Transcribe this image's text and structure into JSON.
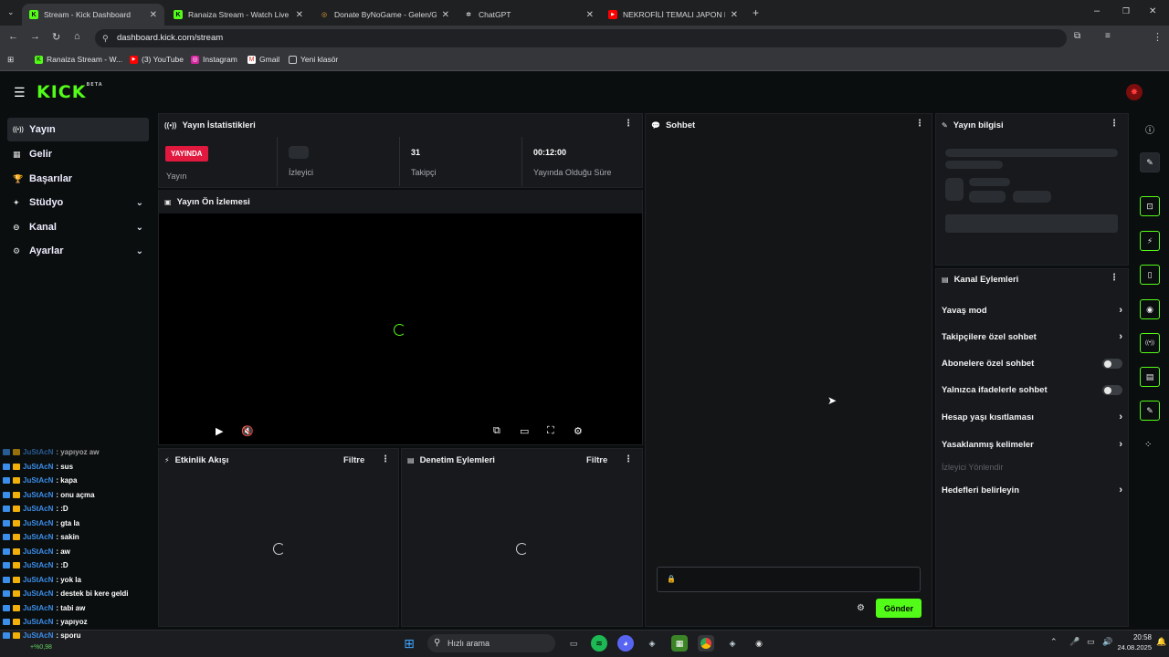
{
  "browser": {
    "tabs": [
      {
        "title": "Stream - Kick Dashboard",
        "fav": "K",
        "favcolor": "#53fc18"
      },
      {
        "title": "Ranaiza Stream - Watch Live on",
        "fav": "K",
        "favcolor": "#53fc18"
      },
      {
        "title": "Donate ByNoGame - Gelen/Gid",
        "fav": "◎",
        "favcolor": "#f2a43a"
      },
      {
        "title": "ChatGPT",
        "fav": "✲",
        "favcolor": "#ffffff"
      },
      {
        "title": "NEKROFİLİ TEMALI JAPON KOR",
        "fav": "▶",
        "favcolor": "#ff0000"
      }
    ],
    "url": "dashboard.kick.com/stream",
    "bookmarks": [
      "Ranaiza Stream - W...",
      "(3) YouTube",
      "Instagram",
      "Gmail",
      "Yeni klasör"
    ]
  },
  "kick": {
    "logo": "KICK",
    "logo_sup": "BETA"
  },
  "sidebar": {
    "items": [
      {
        "label": "Yayın",
        "icon": "((•))",
        "chev": ""
      },
      {
        "label": "Gelir",
        "icon": "▦",
        "chev": ""
      },
      {
        "label": "Başarılar",
        "icon": "🏆",
        "chev": ""
      },
      {
        "label": "Stüdyo",
        "icon": "✦",
        "chev": "⌄"
      },
      {
        "label": "Kanal",
        "icon": "⊖",
        "chev": "⌄"
      },
      {
        "label": "Ayarlar",
        "icon": "⚙",
        "chev": "⌄"
      }
    ]
  },
  "stats": {
    "title": "Yayın İstatistikleri",
    "live_badge": "YAYINDA",
    "live_label": "Yayın",
    "viewers_label": "İzleyici",
    "followers_value": "31",
    "followers_label": "Takipçi",
    "uptime_value": "00:12:00",
    "uptime_label": "Yayında Olduğu Süre"
  },
  "preview": {
    "title": "Yayın Ön İzlemesi"
  },
  "activity": {
    "title": "Etkinlik Akışı",
    "filter": "Filtre"
  },
  "moderation": {
    "title": "Denetim Eylemleri",
    "filter": "Filtre"
  },
  "chat": {
    "title": "Sohbet",
    "send": "Gönder"
  },
  "info": {
    "title": "Yayın bilgisi"
  },
  "channel_actions": {
    "title": "Kanal Eylemleri",
    "slow_mode": "Yavaş mod",
    "followers_only": "Takipçilere özel sohbet",
    "subs_only": "Abonelere özel sohbet",
    "emotes_only": "Yalnızca ifadelerle sohbet",
    "account_age": "Hesap yaşı kısıtlaması",
    "banned_words": "Yasaklanmış kelimeler",
    "viewer_redirect": "İzleyici Yönlendir",
    "goals": "Hedefleri belirleyin"
  },
  "overlay_chat": [
    {
      "user": "JuStAcN",
      "msg": ": yapıyoz aw"
    },
    {
      "user": "JuStAcN",
      "msg": ": sus"
    },
    {
      "user": "JuStAcN",
      "msg": ": kapa"
    },
    {
      "user": "JuStAcN",
      "msg": ": onu açma"
    },
    {
      "user": "JuStAcN",
      "msg": ": :D"
    },
    {
      "user": "JuStAcN",
      "msg": ": gta la"
    },
    {
      "user": "JuStAcN",
      "msg": ": sakin"
    },
    {
      "user": "JuStAcN",
      "msg": ": aw"
    },
    {
      "user": "JuStAcN",
      "msg": ": :D"
    },
    {
      "user": "JuStAcN",
      "msg": ": yok la"
    },
    {
      "user": "JuStAcN",
      "msg": ": destek bi kere geldi"
    },
    {
      "user": "JuStAcN",
      "msg": ": tabi aw"
    },
    {
      "user": "JuStAcN",
      "msg": ": yapıyoz"
    },
    {
      "user": "JuStAcN",
      "msg": ": sporu"
    }
  ],
  "taskbar": {
    "search": "Hızlı arama",
    "weather": "+%0,98",
    "time": "20:58",
    "date": "24.08.2025"
  },
  "colors": {
    "accent": "#53fc18",
    "live": "#e1193f"
  }
}
